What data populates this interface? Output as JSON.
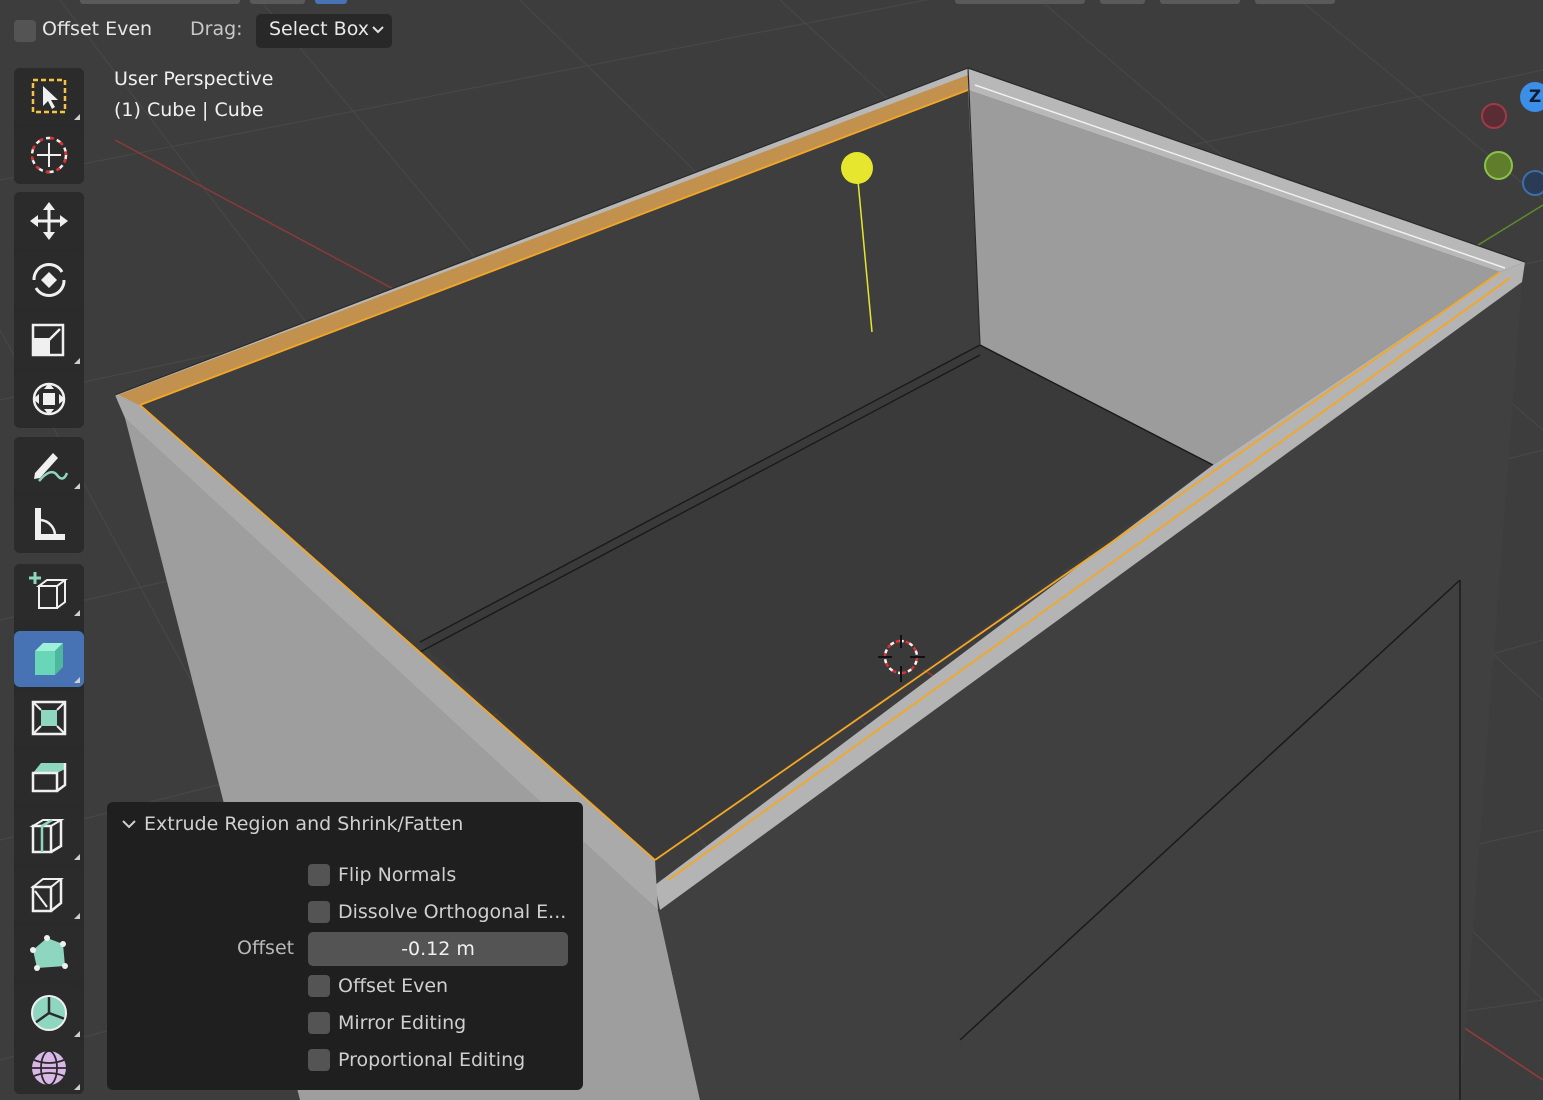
{
  "header": {
    "offset_even_label": "Offset Even",
    "drag_label": "Drag:",
    "drag_value": "Select Box"
  },
  "overlay": {
    "view_name": "User Perspective",
    "object_info": "(1) Cube | Cube"
  },
  "toolbar": {
    "tools": [
      {
        "name": "select-box",
        "active": false
      },
      {
        "name": "cursor",
        "active": false
      },
      {
        "name": "move",
        "active": false
      },
      {
        "name": "rotate",
        "active": false
      },
      {
        "name": "scale",
        "active": false
      },
      {
        "name": "transform",
        "active": false
      },
      {
        "name": "annotate",
        "active": false
      },
      {
        "name": "measure",
        "active": false
      },
      {
        "name": "add-cube",
        "active": false
      },
      {
        "name": "extrude-region",
        "active": true
      },
      {
        "name": "inset-faces",
        "active": false
      },
      {
        "name": "bevel",
        "active": false
      },
      {
        "name": "loop-cut",
        "active": false
      },
      {
        "name": "knife",
        "active": false
      },
      {
        "name": "poly-build",
        "active": false
      },
      {
        "name": "spin",
        "active": false
      },
      {
        "name": "smooth",
        "active": false
      }
    ]
  },
  "operator_panel": {
    "title": "Extrude Region and Shrink/Fatten",
    "flip_normals": "Flip Normals",
    "dissolve_orthogonal": "Dissolve Orthogonal E...",
    "offset_label": "Offset",
    "offset_value": "-0.12 m",
    "offset_even": "Offset Even",
    "mirror_editing": "Mirror Editing",
    "proportional_editing": "Proportional Editing"
  },
  "gizmo": {
    "z_label": "Z",
    "x_color": "#e0404f",
    "y_color": "#8bc34a",
    "z_color": "#3d8ee6"
  },
  "colors": {
    "active_tool": "#4772b3",
    "selection": "#f5a623",
    "light": "#e6e62e"
  }
}
